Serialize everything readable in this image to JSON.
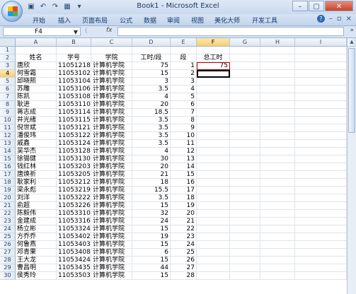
{
  "window": {
    "title": "Book1 - Microsoft Excel",
    "buttons": [
      "–",
      "▢",
      "✕"
    ]
  },
  "qat": {
    "icons": [
      "save-icon",
      "undo-icon",
      "redo-icon",
      "chart-icon",
      "dropdown-icon"
    ]
  },
  "ribbon": {
    "tabs": [
      "开始",
      "插入",
      "页面布局",
      "公式",
      "数据",
      "审阅",
      "视图",
      "美化大师",
      "开发工具"
    ]
  },
  "formula_bar": {
    "name_box": "F4",
    "fx": "fx",
    "formula": ""
  },
  "columns": [
    "A",
    "B",
    "C",
    "D",
    "E",
    "F",
    "G",
    "H",
    "I"
  ],
  "selected": {
    "column": "F",
    "row": "4"
  },
  "rows": [
    {
      "n": "1",
      "A": "",
      "B": "",
      "C": "",
      "D": "",
      "E": "",
      "F": ""
    },
    {
      "n": "2",
      "A": "姓名",
      "B": "学号",
      "C": "学院",
      "D": "工时/段",
      "E": "段",
      "F": "总工时"
    },
    {
      "n": "3",
      "A": "唐欣",
      "B": "11051218",
      "C": "计算机学院",
      "D": "75",
      "E": "1",
      "F": "75"
    },
    {
      "n": "4",
      "A": "何雪霜",
      "B": "11053102",
      "C": "计算机学院",
      "D": "15",
      "E": "2",
      "F": ""
    },
    {
      "n": "5",
      "A": "邱晓熙",
      "B": "11053104",
      "C": "计算机学院",
      "D": "3",
      "E": "3",
      "F": ""
    },
    {
      "n": "6",
      "A": "苏雕",
      "B": "11053106",
      "C": "计算机学院",
      "D": "3.5",
      "E": "4",
      "F": ""
    },
    {
      "n": "7",
      "A": "陈凯",
      "B": "11053108",
      "C": "计算机学院",
      "D": "4",
      "E": "5",
      "F": ""
    },
    {
      "n": "8",
      "A": "耿进",
      "B": "11053110",
      "C": "计算机学院",
      "D": "20",
      "E": "6",
      "F": ""
    },
    {
      "n": "9",
      "A": "蒋志成",
      "B": "11053114",
      "C": "计算机学院",
      "D": "18.5",
      "E": "7",
      "F": ""
    },
    {
      "n": "10",
      "A": "井光绪",
      "B": "11053115",
      "C": "计算机学院",
      "D": "3.5",
      "E": "8",
      "F": ""
    },
    {
      "n": "11",
      "A": "倪世斌",
      "B": "11053121",
      "C": "计算机学院",
      "D": "3.5",
      "E": "9",
      "F": ""
    },
    {
      "n": "12",
      "A": "潘俊玮",
      "B": "11053122",
      "C": "计算机学院",
      "D": "3.5",
      "E": "10",
      "F": ""
    },
    {
      "n": "13",
      "A": "戚鑫",
      "B": "11053124",
      "C": "计算机学院",
      "D": "3.5",
      "E": "11",
      "F": ""
    },
    {
      "n": "14",
      "A": "吴华杰",
      "B": "11053128",
      "C": "计算机学院",
      "D": "4",
      "E": "12",
      "F": ""
    },
    {
      "n": "15",
      "A": "徐锡健",
      "B": "11053130",
      "C": "计算机学院",
      "D": "30",
      "E": "13",
      "F": ""
    },
    {
      "n": "16",
      "A": "钱红林",
      "B": "11053203",
      "C": "计算机学院",
      "D": "20",
      "E": "14",
      "F": ""
    },
    {
      "n": "17",
      "A": "唐焕祈",
      "B": "11053205",
      "C": "计算机学院",
      "D": "21",
      "E": "15",
      "F": ""
    },
    {
      "n": "18",
      "A": "耿家利",
      "B": "11053212",
      "C": "计算机学院",
      "D": "18",
      "E": "16",
      "F": ""
    },
    {
      "n": "19",
      "A": "梁永彪",
      "B": "11053219",
      "C": "计算机学院",
      "D": "15.5",
      "E": "17",
      "F": ""
    },
    {
      "n": "20",
      "A": "刘洋",
      "B": "11053222",
      "C": "计算机学院",
      "D": "3.5",
      "E": "18",
      "F": ""
    },
    {
      "n": "21",
      "A": "俞超",
      "B": "11053226",
      "C": "计算机学院",
      "D": "15",
      "E": "19",
      "F": ""
    },
    {
      "n": "22",
      "A": "陈毅伟",
      "B": "11053310",
      "C": "计算机学院",
      "D": "32",
      "E": "20",
      "F": ""
    },
    {
      "n": "23",
      "A": "金建成",
      "B": "11053316",
      "C": "计算机学院",
      "D": "24",
      "E": "21",
      "F": ""
    },
    {
      "n": "24",
      "A": "杨立彬",
      "B": "11053324",
      "C": "计算机学院",
      "D": "15",
      "E": "22",
      "F": ""
    },
    {
      "n": "25",
      "A": "方乔乔",
      "B": "11053402",
      "C": "计算机学院",
      "D": "19",
      "E": "23",
      "F": ""
    },
    {
      "n": "26",
      "A": "何鲁燕",
      "B": "11053403",
      "C": "计算机学院",
      "D": "15",
      "E": "24",
      "F": ""
    },
    {
      "n": "27",
      "A": "邓青果",
      "B": "11053408",
      "C": "计算机学院",
      "D": "6",
      "E": "25",
      "F": ""
    },
    {
      "n": "28",
      "A": "王大龙",
      "B": "11053424",
      "C": "计算机学院",
      "D": "15",
      "E": "26",
      "F": ""
    },
    {
      "n": "29",
      "A": "曹昌明",
      "B": "11053435",
      "C": "计算机学院",
      "D": "44",
      "E": "27",
      "F": ""
    },
    {
      "n": "30",
      "A": "侯秀玲",
      "B": "11053503",
      "C": "计算机学院",
      "D": "15",
      "E": "28",
      "F": ""
    }
  ]
}
